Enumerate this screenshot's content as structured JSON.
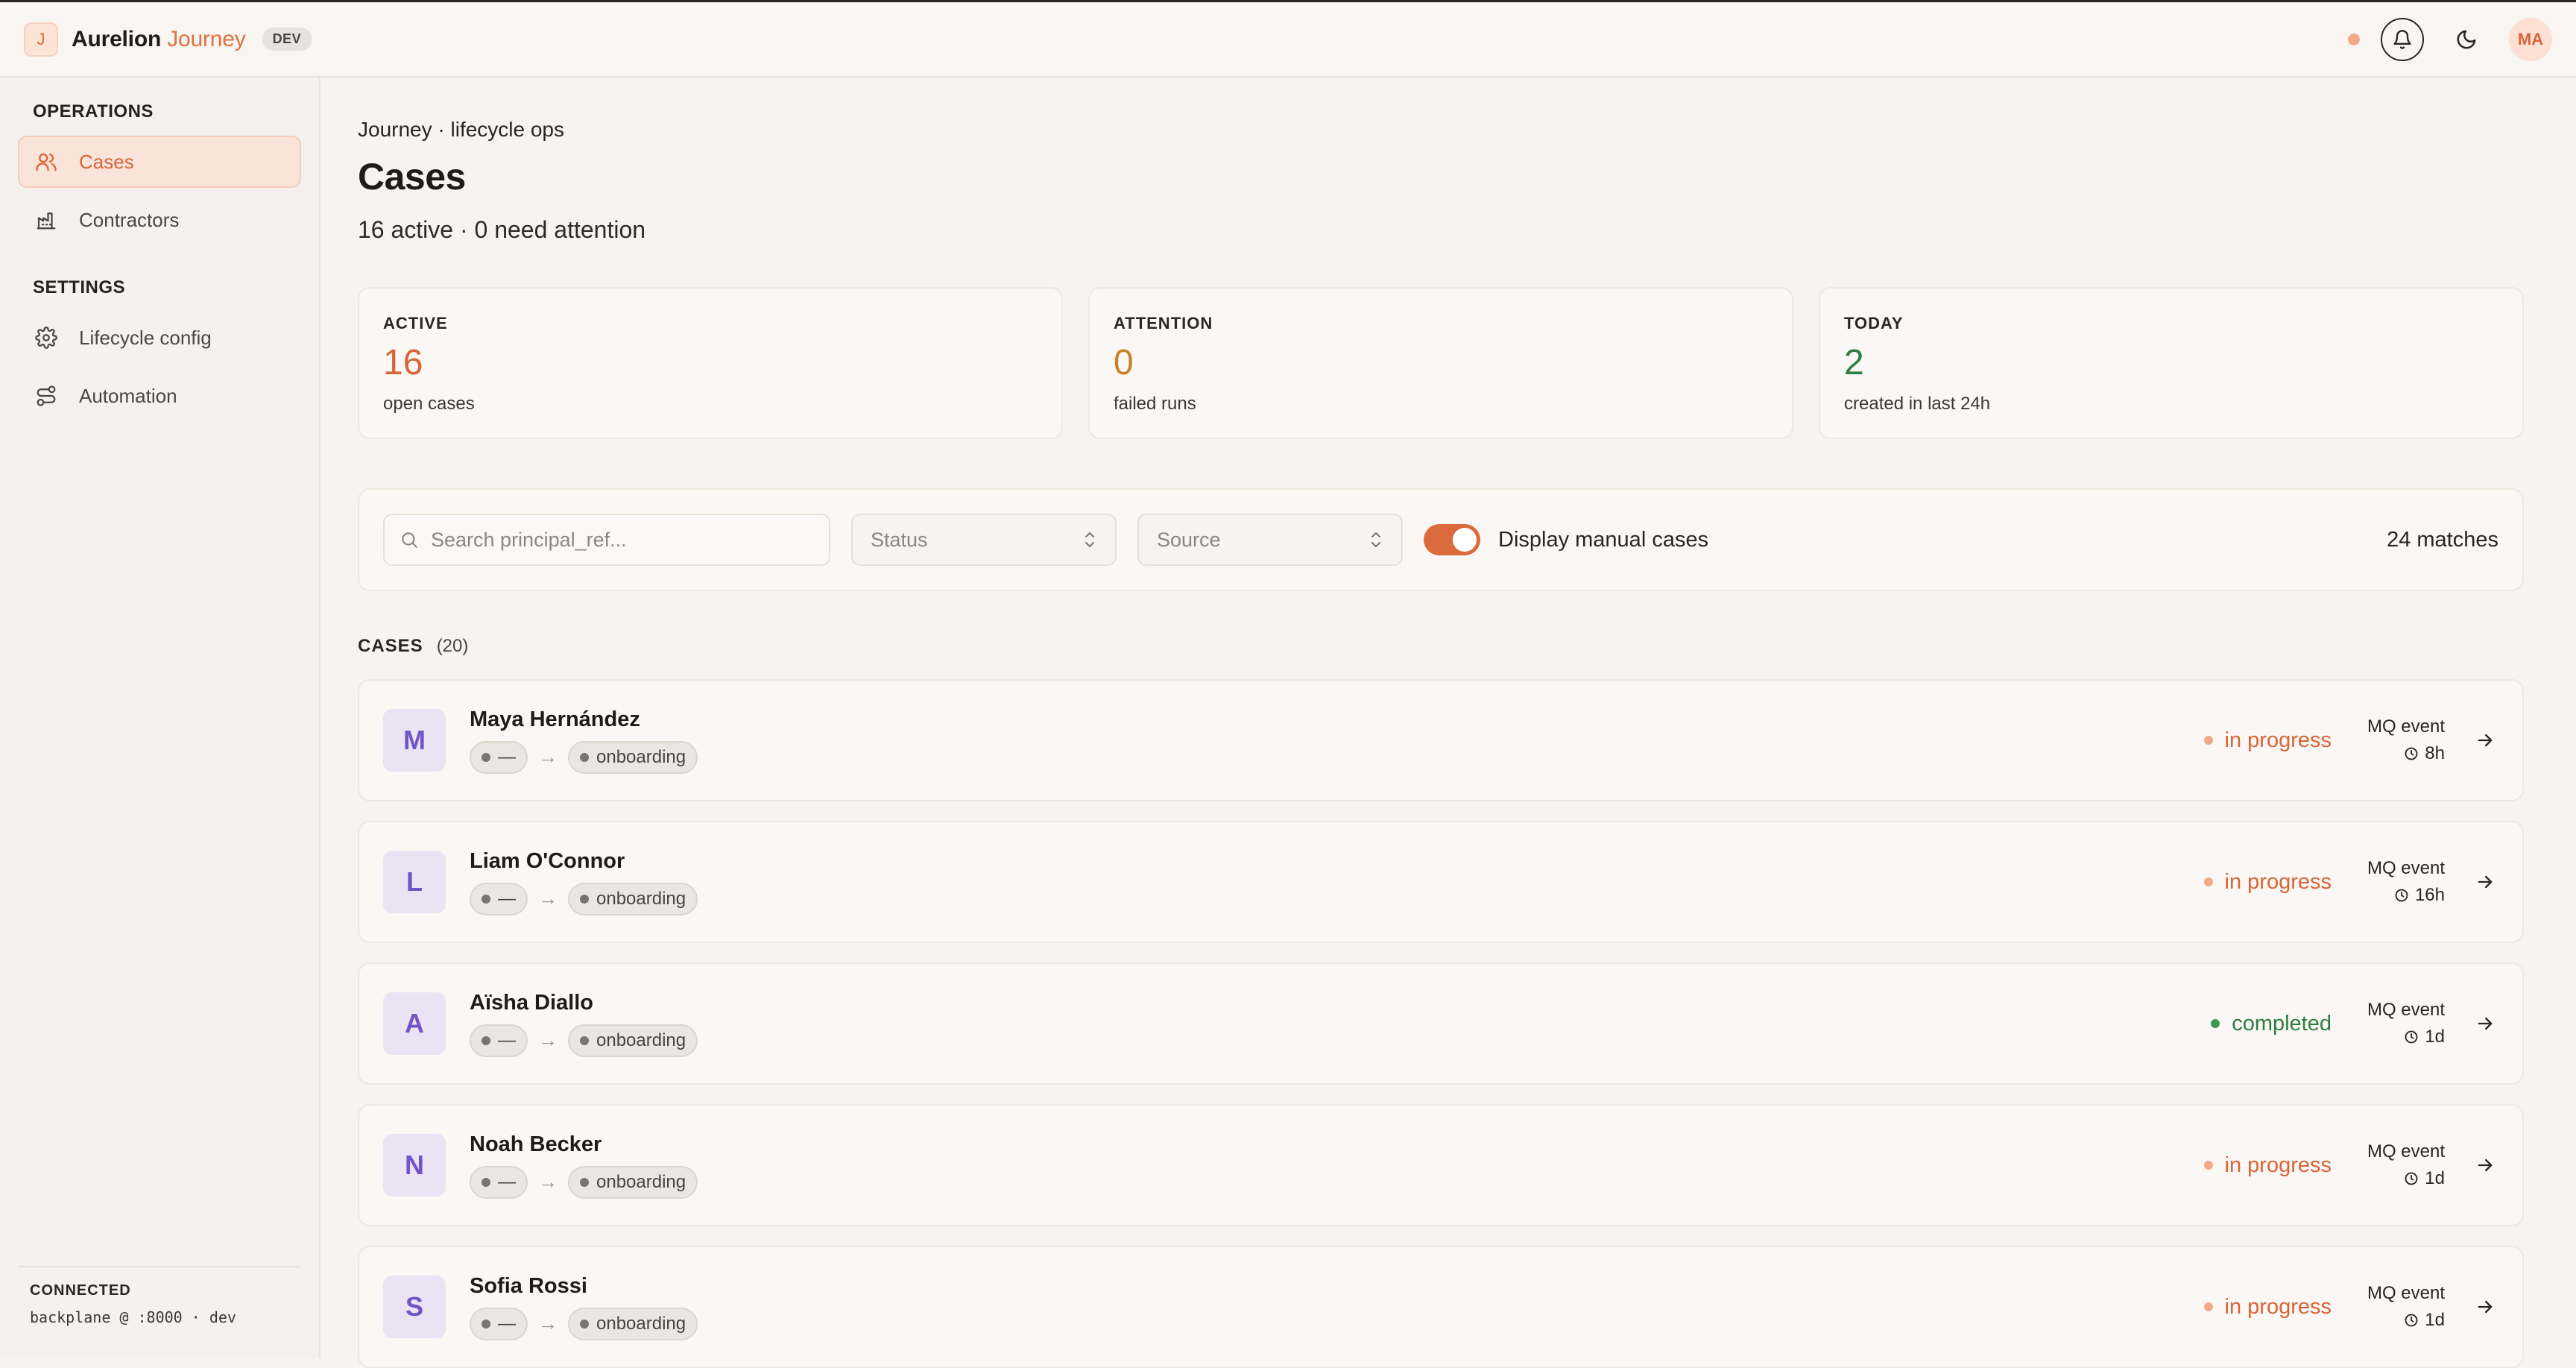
{
  "app": {
    "logo_letter": "J",
    "brand_name": "Aurelion",
    "brand_accent": "Journey",
    "env": "DEV",
    "user_initials": "MA"
  },
  "sidebar": {
    "sections": [
      {
        "label": "OPERATIONS",
        "items": [
          {
            "label": "Cases",
            "icon": "users-icon",
            "active": true
          },
          {
            "label": "Contractors",
            "icon": "factory-icon",
            "active": false
          }
        ]
      },
      {
        "label": "SETTINGS",
        "items": [
          {
            "label": "Lifecycle config",
            "icon": "gear-icon",
            "active": false
          },
          {
            "label": "Automation",
            "icon": "route-icon",
            "active": false
          }
        ]
      }
    ],
    "footer": {
      "label": "CONNECTED",
      "value": "backplane @ :8000 · dev"
    }
  },
  "page": {
    "breadcrumb": "Journey · lifecycle ops",
    "title": "Cases",
    "subtitle": "16 active · 0 need attention"
  },
  "stats": [
    {
      "label": "ACTIVE",
      "value": "16",
      "caption": "open cases"
    },
    {
      "label": "ATTENTION",
      "value": "0",
      "caption": "failed runs"
    },
    {
      "label": "TODAY",
      "value": "2",
      "caption": "created in last 24h"
    }
  ],
  "filters": {
    "search_placeholder": "Search principal_ref...",
    "status_placeholder": "Status",
    "source_placeholder": "Source",
    "toggle_label": "Display manual cases",
    "toggle_on": true,
    "match_count": "24 matches"
  },
  "cases": {
    "title": "CASES",
    "count": "(20)",
    "rows": [
      {
        "initial": "M",
        "name": "Maya Hernández",
        "from_stage": "—",
        "to_stage": "onboarding",
        "status": "in progress",
        "source": "MQ event",
        "age": "8h"
      },
      {
        "initial": "L",
        "name": "Liam O'Connor",
        "from_stage": "—",
        "to_stage": "onboarding",
        "status": "in progress",
        "source": "MQ event",
        "age": "16h"
      },
      {
        "initial": "A",
        "name": "Aïsha Diallo",
        "from_stage": "—",
        "to_stage": "onboarding",
        "status": "completed",
        "source": "MQ event",
        "age": "1d"
      },
      {
        "initial": "N",
        "name": "Noah Becker",
        "from_stage": "—",
        "to_stage": "onboarding",
        "status": "in progress",
        "source": "MQ event",
        "age": "1d"
      },
      {
        "initial": "S",
        "name": "Sofia Rossi",
        "from_stage": "—",
        "to_stage": "onboarding",
        "status": "in progress",
        "source": "MQ event",
        "age": "1d"
      }
    ]
  },
  "colors": {
    "accent": "#d96437",
    "attention": "#c98222",
    "success": "#2f7d43",
    "avatar_bg": "#ebe3f4",
    "avatar_fg": "#7453c7"
  }
}
